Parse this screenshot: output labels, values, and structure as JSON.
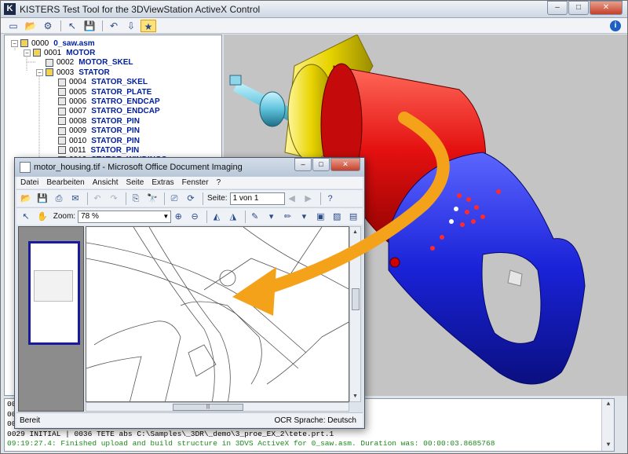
{
  "main_window": {
    "title": "KISTERS Test Tool for the 3DViewStation ActiveX Control",
    "app_icon_text": "K",
    "buttons": [
      "–",
      "□",
      "✕"
    ]
  },
  "toolbar": {
    "icons": [
      "new-icon",
      "open-icon",
      "settings-icon",
      "select-icon",
      "save-icon",
      "undo-icon",
      "download-icon",
      "star-icon"
    ],
    "info_label": "i"
  },
  "tree": [
    {
      "num": "0000",
      "name": "0_saw.asm",
      "depth": 0,
      "type": "asm",
      "expanded": true
    },
    {
      "num": "0001",
      "name": "MOTOR",
      "depth": 1,
      "type": "asm",
      "expanded": true
    },
    {
      "num": "0002",
      "name": "MOTOR_SKEL",
      "depth": 2,
      "type": "part"
    },
    {
      "num": "0003",
      "name": "STATOR",
      "depth": 2,
      "type": "asm",
      "expanded": true
    },
    {
      "num": "0004",
      "name": "STATOR_SKEL",
      "depth": 3,
      "type": "part"
    },
    {
      "num": "0005",
      "name": "STATOR_PLATE",
      "depth": 3,
      "type": "part"
    },
    {
      "num": "0006",
      "name": "STATRO_ENDCAP",
      "depth": 3,
      "type": "part"
    },
    {
      "num": "0007",
      "name": "STATRO_ENDCAP",
      "depth": 3,
      "type": "part"
    },
    {
      "num": "0008",
      "name": "STATOR_PIN",
      "depth": 3,
      "type": "part"
    },
    {
      "num": "0009",
      "name": "STATOR_PIN",
      "depth": 3,
      "type": "part"
    },
    {
      "num": "0010",
      "name": "STATOR_PIN",
      "depth": 3,
      "type": "part"
    },
    {
      "num": "0011",
      "name": "STATOR_PIN",
      "depth": 3,
      "type": "part"
    },
    {
      "num": "0012",
      "name": "STATOR_WINDINGS",
      "depth": 3,
      "type": "part"
    }
  ],
  "log": {
    "lines": [
      {
        "text": "00",
        "color": "black"
      },
      {
        "text": "00",
        "color": "black"
      },
      {
        "text": "00",
        "color": "black"
      },
      {
        "text": "0029 INITIAL | 0036 TETE abs C:\\Samples\\_3DR\\_demo\\3_proe_EX_2\\tete.prt.1",
        "color": "black"
      },
      {
        "text": "09:19:27.4: Finished upload and build structure in 3DVS ActiveX for 0_saw.asm. Duration was: 00:00:03.8685768",
        "color": "green"
      }
    ]
  },
  "doc_window": {
    "title": "motor_housing.tif - Microsoft Office Document Imaging",
    "buttons": [
      "–",
      "□",
      "✕"
    ],
    "menu": [
      "Datei",
      "Bearbeiten",
      "Ansicht",
      "Seite",
      "Extras",
      "Fenster",
      "?"
    ],
    "page_label": "Seite:",
    "page_value": "1 von 1",
    "zoom_label": "Zoom:",
    "zoom_value": "78 %",
    "status_left": "Bereit",
    "status_right": "OCR Sprache: Deutsch",
    "hscroll_grip": "|||"
  },
  "colors": {
    "arrow": "#f5a21b",
    "housing_red": "#e01010",
    "handle_blue": "#1a22d8",
    "flange_yellow": "#e8d400",
    "log_green": "#1b8a1b"
  }
}
